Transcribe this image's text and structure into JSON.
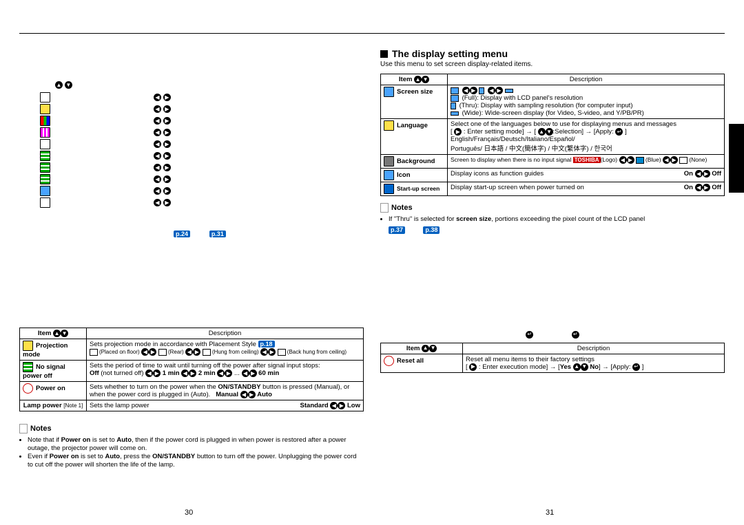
{
  "page_left_num": "30",
  "page_right_num": "31",
  "image_adjust": {
    "arrows_pair": "◀ ▶"
  },
  "left_prefs": {
    "a": "p.24",
    "b": "p.31"
  },
  "default_table": {
    "head_item": "Item",
    "head_desc": "Description",
    "rows": {
      "proj": {
        "item": "Projection mode",
        "desc": "Sets projection mode in accordance with Placement Style",
        "pref": "p.18",
        "opts": {
          "a": "(Placed on floor)",
          "b": "(Rear)",
          "c": "(Hung from ceiling)",
          "d": "(Back hung from ceiling)"
        }
      },
      "nosignal": {
        "item": "No signal power off",
        "desc": "Sets the period of time to wait until turning off the power after signal input stops:",
        "opts": "Off (not turned off)  1 min  2 min  ...  60 min"
      },
      "poweron": {
        "item": "Power on",
        "desc": "Sets whether to turn on the power when the ON/STANDBY button is pressed (Manual), or when the power cord is plugged in (Auto).",
        "opts_a": "Manual",
        "opts_b": "Auto"
      },
      "lamp": {
        "item": "Lamp power",
        "note": "[Note 1]",
        "desc": "Sets the lamp power",
        "opts_a": "Standard",
        "opts_b": "Low"
      }
    }
  },
  "left_notes": {
    "title": "Notes",
    "body1": "Note that if Power on is set to Auto, then if the power cord is plugged in when power is restored after a power outage, the projector power will come on.",
    "body2": "Even if Power on is set to Auto, press the ON/STANDBY button to turn off the power. Unplugging the power cord to cut off the power will shorten the life of the lamp."
  },
  "right": {
    "title": "The display setting menu",
    "sub": "Use this menu to set screen display-related items.",
    "table": {
      "head_item": "Item",
      "head_desc": "Description",
      "screen": {
        "item": "Screen size",
        "full": "(Full):  Display with LCD panel's resolution",
        "thru": "(Thru):  Display with sampling resolution (for computer input)",
        "wide": "(Wide):  Wide-screen display (for Video, S-video, and Y/PB/PR)"
      },
      "lang": {
        "item": "Language",
        "l1": "Select one of the languages below to use for displaying menus and messages",
        "l2": "[  : Enter setting mode] → [   :Selection] → [Apply:  ]",
        "l3": "English/Français/Deutsch/Italiano/Español/",
        "l4": "Português/ 日本語 / 中文(簡体字) / 中文(繁体字) / 한국어"
      },
      "bg": {
        "item": "Background",
        "desc": "Screen to display when there is no input signal",
        "a": "(Logo)",
        "b": "(Blue)",
        "c": "(None)",
        "tag": "TOSHIBA"
      },
      "icon": {
        "item": "Icon",
        "desc": "Display icons as function guides",
        "on": "On",
        "off": "Off"
      },
      "start": {
        "item": "Start-up screen",
        "desc": "Display start-up screen when power turned on",
        "on": "On",
        "off": "Off"
      }
    },
    "notes": {
      "title": "Notes",
      "body": "If \"Thru\" is selected for screen size, portions exceeding the pixel count of the LCD panel",
      "pref_a": "p.37",
      "pref_b": "p.38"
    },
    "reset": {
      "head_item": "Item",
      "head_desc": "Description",
      "item": "Reset all",
      "desc": "Reset all menu items to their factory settings",
      "line2": "[  : Enter execution mode] → [Yes    No] → [Apply:  ]"
    }
  }
}
